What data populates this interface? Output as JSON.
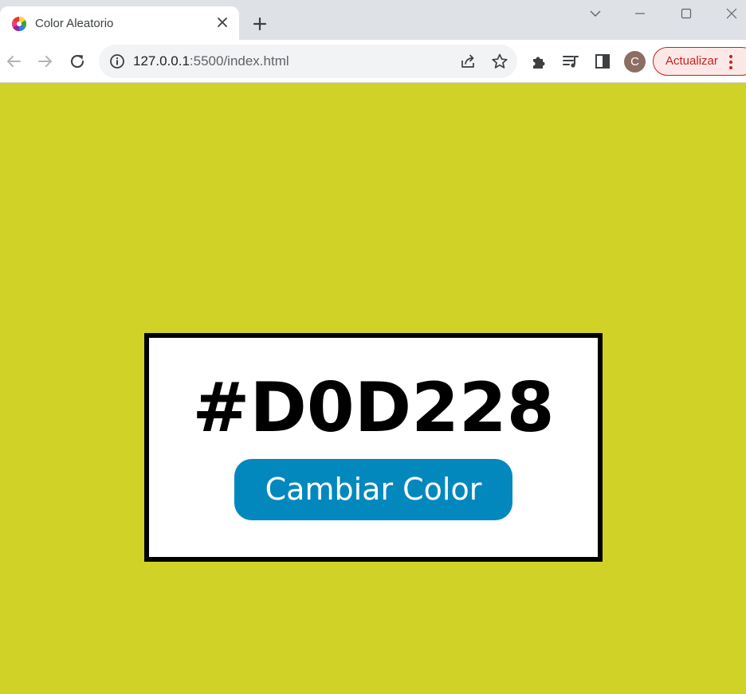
{
  "browser": {
    "tab": {
      "title": "Color Aleatorio"
    },
    "address_bar": {
      "host": "127.0.0.1",
      "path": ":5500/index.html"
    },
    "profile": {
      "initial": "C"
    },
    "update_button": {
      "label": "Actualizar"
    },
    "icons": [
      "color-wheel-favicon-icon",
      "close-icon",
      "plus-icon",
      "chevron-down-icon",
      "minimize-icon",
      "maximize-icon",
      "close-window-icon",
      "back-arrow-icon",
      "forward-arrow-icon",
      "reload-icon",
      "info-icon",
      "share-icon",
      "star-icon",
      "puzzle-extensions-icon",
      "media-queue-icon",
      "side-panel-icon",
      "kebab-menu-icon"
    ]
  },
  "page": {
    "background_color": "#D0D228",
    "hex_code": "#D0D228",
    "button": {
      "label": "Cambiar Color",
      "color": "#0388BE"
    }
  }
}
